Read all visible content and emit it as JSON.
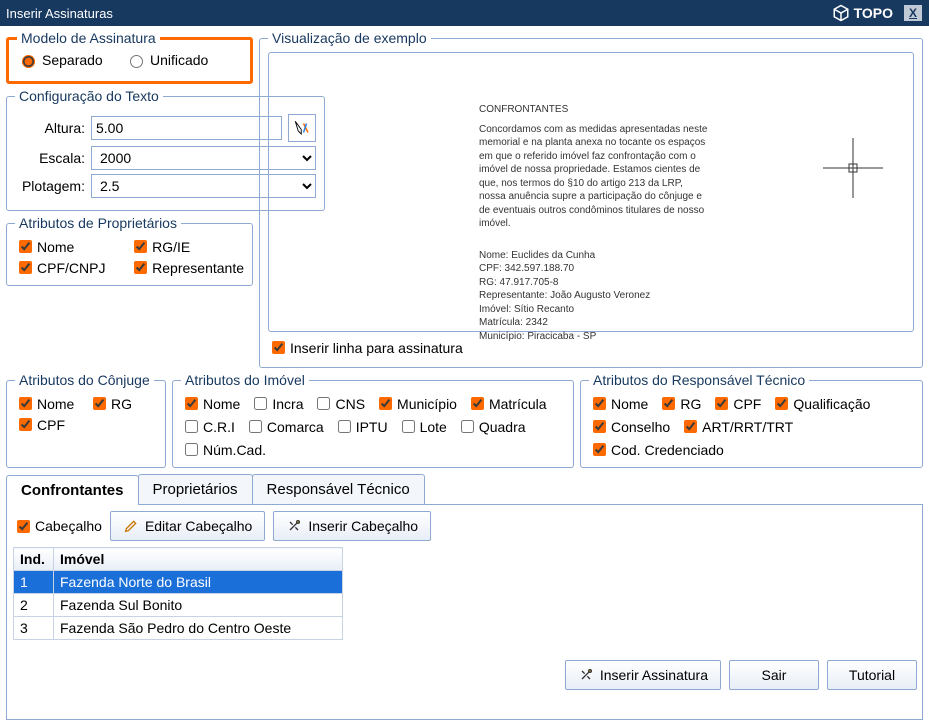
{
  "title": "Inserir Assinaturas",
  "logo": "TOPO",
  "modelo": {
    "legend": "Modelo de Assinatura",
    "separado": "Separado",
    "unificado": "Unificado"
  },
  "cfg": {
    "legend": "Configuração do Texto",
    "altura_lbl": "Altura:",
    "altura_val": "5.00",
    "escala_lbl": "Escala:",
    "escala_val": "2000",
    "plotagem_lbl": "Plotagem:",
    "plotagem_val": "2.5"
  },
  "attr_prop": {
    "legend": "Atributos de Proprietários",
    "nome": "Nome",
    "rgie": "RG/IE",
    "cpfcnpj": "CPF/CNPJ",
    "repr": "Representante"
  },
  "attr_conj": {
    "legend": "Atributos do Cônjuge",
    "nome": "Nome",
    "rg": "RG",
    "cpf": "CPF"
  },
  "attr_imovel": {
    "legend": "Atributos do Imóvel",
    "nome": "Nome",
    "incra": "Incra",
    "cns": "CNS",
    "municipio": "Município",
    "matricula": "Matrícula",
    "cri": "C.R.I",
    "comarca": "Comarca",
    "iptu": "IPTU",
    "lote": "Lote",
    "quadra": "Quadra",
    "numcad": "Núm.Cad."
  },
  "attr_rt": {
    "legend": "Atributos do Responsável Técnico",
    "nome": "Nome",
    "rg": "RG",
    "cpf": "CPF",
    "qualif": "Qualificação",
    "conselho": "Conselho",
    "art": "ART/RRT/TRT",
    "cod": "Cod. Credenciado"
  },
  "preview": {
    "legend": "Visualização de exemplo",
    "header": "CONFRONTANTES",
    "body1": "Concordamos com as medidas apresentadas neste memorial e na planta anexa no tocante os espaços em que o referido imóvel faz confrontação com o imóvel de nossa propriedade. Estamos cientes de que, nos termos do §10 do artigo 213 da LRP, nossa anuência supre a participação do cônjuge e de eventuais outros condôminos titulares de nosso imóvel.",
    "l1": "Nome: Euclides da Cunha",
    "l2": "CPF: 342.597.188.70",
    "l3": "RG: 47.917.705-8",
    "l4": "Representante: João Augusto Veronez",
    "l5": "Imóvel: Sítio Recanto",
    "l6": "Matrícula: 2342",
    "l7": "Município: Piracicaba - SP",
    "insert_line": "Inserir linha para assinatura"
  },
  "tabs": {
    "t1": "Confrontantes",
    "t2": "Proprietários",
    "t3": "Responsável Técnico"
  },
  "toolbar": {
    "cabecalho": "Cabeçalho",
    "editar": "Editar Cabeçalho",
    "inserir": "Inserir Cabeçalho"
  },
  "table": {
    "h1": "Ind.",
    "h2": "Imóvel",
    "r1i": "1",
    "r1n": "Fazenda Norte do Brasil",
    "r2i": "2",
    "r2n": "Fazenda Sul Bonito",
    "r3i": "3",
    "r3n": "Fazenda São Pedro do Centro Oeste"
  },
  "footer": {
    "inserir": "Inserir Assinatura",
    "sair": "Sair",
    "tutorial": "Tutorial"
  }
}
